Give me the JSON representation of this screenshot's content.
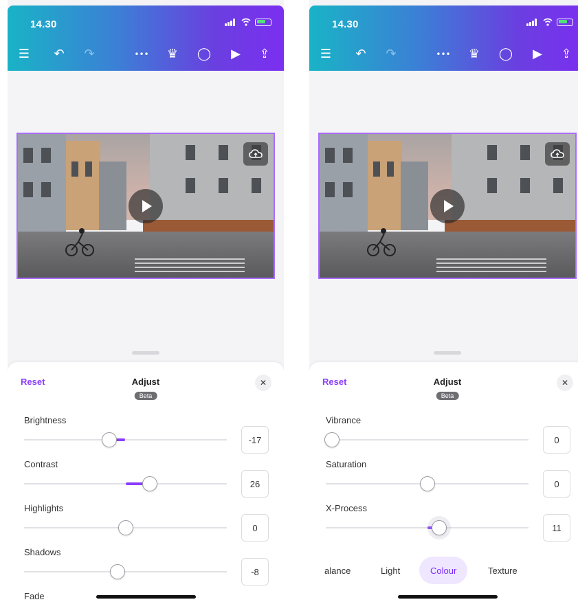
{
  "status_bar": {
    "time": "14.30"
  },
  "toolbar": {
    "menu_icon": "☰",
    "undo_icon": "↶",
    "redo_icon": "↷",
    "more_icon": "•••",
    "crown_icon": "♛",
    "comment_icon": "◯",
    "play_icon": "▶",
    "share_icon": "⇪"
  },
  "colors": {
    "accent": "#8b3dff",
    "gradient_start": "#19b3c6",
    "gradient_end": "#7b2ff0"
  },
  "left_screen": {
    "sheet": {
      "reset_label": "Reset",
      "title": "Adjust",
      "badge": "Beta",
      "close_icon": "✕"
    },
    "sliders": [
      {
        "label": "Brightness",
        "value": "-17",
        "position": 0.42,
        "fill_from": 0.5,
        "fill_to": 0.42
      },
      {
        "label": "Contrast",
        "value": "26",
        "position": 0.62,
        "fill_from": 0.5,
        "fill_to": 0.62
      },
      {
        "label": "Highlights",
        "value": "0",
        "position": 0.5,
        "fill_from": 0.5,
        "fill_to": 0.5
      },
      {
        "label": "Shadows",
        "value": "-8",
        "position": 0.46,
        "fill_from": 0.5,
        "fill_to": 0.46
      }
    ],
    "peek_label": "Fade"
  },
  "right_screen": {
    "sheet": {
      "reset_label": "Reset",
      "title": "Adjust",
      "badge": "Beta",
      "close_icon": "✕"
    },
    "sliders": [
      {
        "label": "Vibrance",
        "value": "0",
        "position": 0.03,
        "fill_from": 0.03,
        "fill_to": 0.03
      },
      {
        "label": "Saturation",
        "value": "0",
        "position": 0.5,
        "fill_from": 0.5,
        "fill_to": 0.5
      },
      {
        "label": "X-Process",
        "value": "11",
        "position": 0.56,
        "fill_from": 0.5,
        "fill_to": 0.56
      }
    ],
    "tabs": [
      {
        "label": "alance",
        "active": false
      },
      {
        "label": "Light",
        "active": false
      },
      {
        "label": "Colour",
        "active": true
      },
      {
        "label": "Texture",
        "active": false
      }
    ]
  }
}
